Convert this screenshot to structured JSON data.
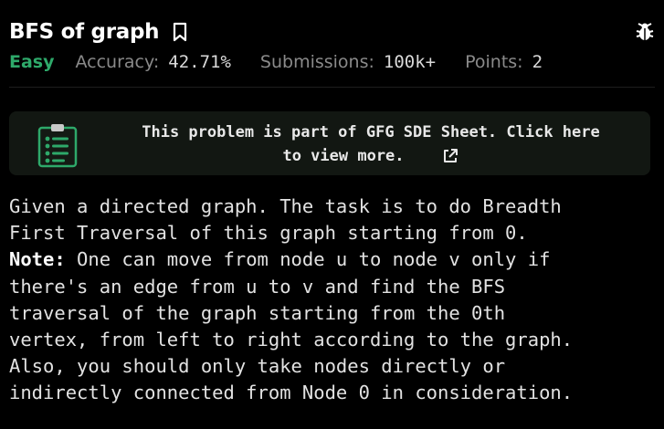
{
  "problem": {
    "title": "BFS of graph",
    "bookmark_icon": "bookmark-icon",
    "report_icon": "bug-icon"
  },
  "meta": {
    "difficulty": "Easy",
    "accuracy_label": "Accuracy:",
    "accuracy_value": "42.71%",
    "submissions_label": "Submissions:",
    "submissions_value": "100k+",
    "points_label": "Points:",
    "points_value": "2"
  },
  "banner": {
    "icon": "checklist-icon",
    "line1": "This problem is part of GFG SDE Sheet. Click here",
    "line2": "to view more.",
    "link_icon": "external-link-icon"
  },
  "description": {
    "lines": [
      "Given a directed graph. The task is to do Breadth",
      "First Traversal of this graph starting from 0."
    ],
    "note_label": "Note:",
    "note_first": " One can move from node u to node v only if",
    "note_lines": [
      "there's an edge from u to v and find the BFS",
      "traversal of the graph starting from the 0th",
      "vertex, from left to right according to the graph.",
      "Also, you should only take nodes directly or",
      "indirectly connected from Node 0 in consideration."
    ]
  },
  "colors": {
    "background": "#000000",
    "difficulty_easy": "#2ea96a",
    "banner_bg": "#121712",
    "icon_green": "#2ea96a"
  }
}
